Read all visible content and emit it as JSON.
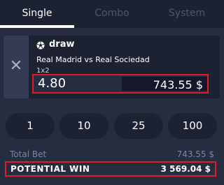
{
  "tabs": [
    {
      "label": "Single",
      "active": true
    },
    {
      "label": "Combo",
      "active": false
    },
    {
      "label": "System",
      "active": false
    }
  ],
  "bet": {
    "selection": "draw",
    "match": "Real Madrid vs Real Sociedad",
    "market": "1x2",
    "odds": "4.80",
    "stake": "743.55 $"
  },
  "quick_stakes": [
    "1",
    "10",
    "25",
    "100"
  ],
  "summary": {
    "total_label": "Total Bet",
    "total_value": "743.55 $",
    "win_label": "POTENTIAL WIN",
    "win_value": "3 569.04 $"
  },
  "colors": {
    "background": "#272d40",
    "panel": "#1d2233",
    "highlight_border": "#e01c24",
    "muted_text": "#7e859c"
  },
  "icons": {
    "remove": "close-icon",
    "sport": "soccer-ball-icon"
  }
}
